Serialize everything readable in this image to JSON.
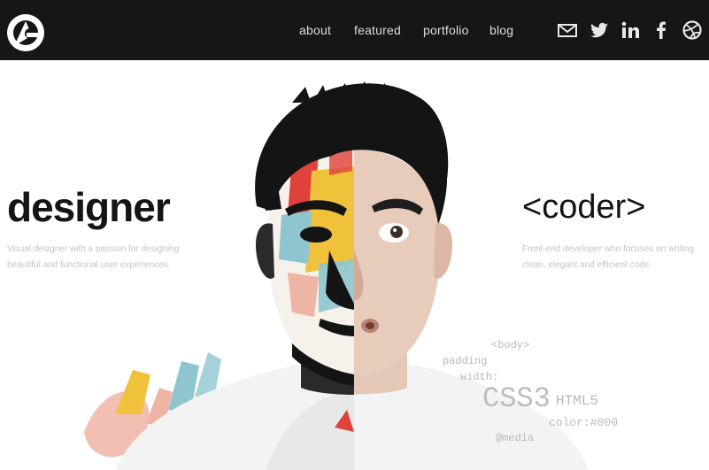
{
  "nav": {
    "links": [
      "about",
      "featured",
      "portfolio",
      "blog"
    ]
  },
  "social": {
    "icons": [
      "mail-icon",
      "twitter-icon",
      "linkedin-icon",
      "facebook-icon",
      "dribbble-icon"
    ]
  },
  "hero": {
    "left": {
      "title": "designer",
      "description": "Visual designer with a passion for designing beautiful and functional user experiences."
    },
    "right": {
      "title": "<coder>",
      "description": "Front-end developer who focuses on writing clean, elegant and efficient code."
    },
    "code_fragments": [
      "<body>",
      "padding",
      "width:",
      "CSS3",
      "HTML5",
      "color:#000",
      "@media"
    ]
  },
  "colors": {
    "navbar": "#161616",
    "background": "#ffffff",
    "text_dark": "#141414",
    "text_light": "#c4c4c4",
    "paint_yellow": "#f0c23c",
    "paint_teal": "#8fc5cf",
    "paint_red": "#e0413b",
    "paint_pink": "#eeb5a4"
  }
}
